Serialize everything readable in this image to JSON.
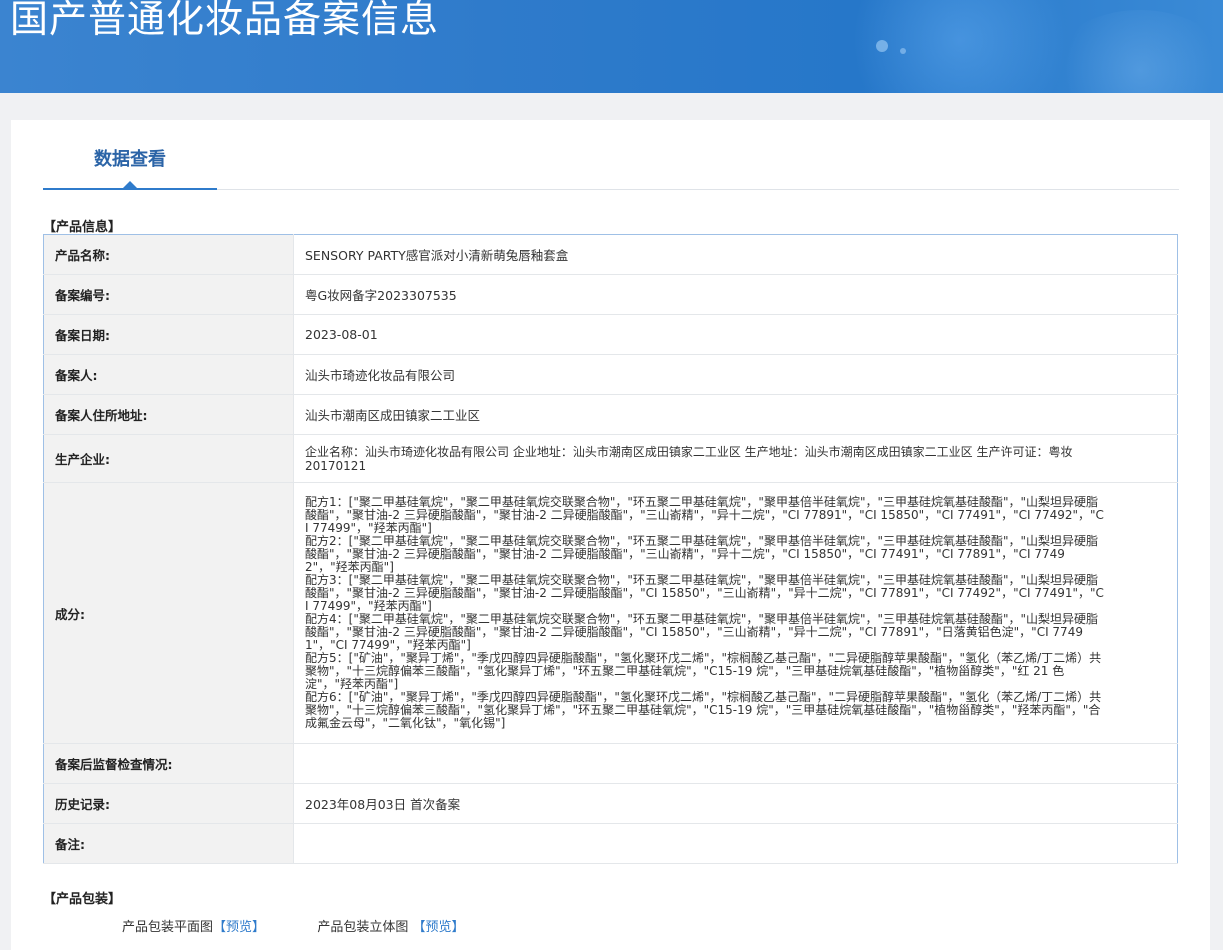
{
  "banner": {
    "title": "国产普通化妆品备案信息"
  },
  "tabs": {
    "active": "数据查看"
  },
  "section_product_info": "【产品信息】",
  "rows": [
    {
      "label": "产品名称:",
      "value": "SENSORY PARTY感官派对小清新萌兔唇釉套盒"
    },
    {
      "label": "备案编号:",
      "value": "粤G妆网备字2023307535"
    },
    {
      "label": "备案日期:",
      "value": "2023-08-01"
    },
    {
      "label": "备案人:",
      "value": "汕头市琦迹化妆品有限公司"
    },
    {
      "label": "备案人住所地址:",
      "value": "汕头市潮南区成田镇家二工业区"
    },
    {
      "label": "生产企业:",
      "value": "企业名称：汕头市琦迹化妆品有限公司 企业地址：汕头市潮南区成田镇家二工业区 生产地址：汕头市潮南区成田镇家二工业区 生产许可证：粤妆20170121"
    },
    {
      "label": "成分:",
      "value": ""
    },
    {
      "label": "备案后监督检查情况:",
      "value": ""
    },
    {
      "label": "历史记录:",
      "value": "2023年08月03日 首次备案"
    },
    {
      "label": "备注:",
      "value": ""
    }
  ],
  "ingredients": [
    "配方1：[\"聚二甲基硅氧烷\"，\"聚二甲基硅氧烷交联聚合物\"，\"环五聚二甲基硅氧烷\"，\"聚甲基倍半硅氧烷\"，\"三甲基硅烷氧基硅酸酯\"，\"山梨坦异硬脂酸酯\"，\"聚甘油-2 三异硬脂酸酯\"，\"聚甘油-2 二异硬脂酸酯\"，\"三山嵛精\"，\"异十二烷\"，\"CI 77891\"，\"CI 15850\"，\"CI 77491\"，\"CI 77492\"，\"CI 77499\"，\"羟苯丙酯\"]",
    "配方2：[\"聚二甲基硅氧烷\"，\"聚二甲基硅氧烷交联聚合物\"，\"环五聚二甲基硅氧烷\"，\"聚甲基倍半硅氧烷\"，\"三甲基硅烷氧基硅酸酯\"，\"山梨坦异硬脂酸酯\"，\"聚甘油-2 三异硬脂酸酯\"，\"聚甘油-2 二异硬脂酸酯\"，\"三山嵛精\"，\"异十二烷\"，\"CI 15850\"，\"CI 77491\"，\"CI 77891\"，\"CI 77492\"，\"羟苯丙酯\"]",
    "配方3：[\"聚二甲基硅氧烷\"，\"聚二甲基硅氧烷交联聚合物\"，\"环五聚二甲基硅氧烷\"，\"聚甲基倍半硅氧烷\"，\"三甲基硅烷氧基硅酸酯\"，\"山梨坦异硬脂酸酯\"，\"聚甘油-2 三异硬脂酸酯\"，\"聚甘油-2 二异硬脂酸酯\"，\"CI 15850\"，\"三山嵛精\"，\"异十二烷\"，\"CI 77891\"，\"CI 77492\"，\"CI 77491\"，\"CI 77499\"，\"羟苯丙酯\"]",
    "配方4：[\"聚二甲基硅氧烷\"，\"聚二甲基硅氧烷交联聚合物\"，\"环五聚二甲基硅氧烷\"，\"聚甲基倍半硅氧烷\"，\"三甲基硅烷氧基硅酸酯\"，\"山梨坦异硬脂酸酯\"，\"聚甘油-2 三异硬脂酸酯\"，\"聚甘油-2 二异硬脂酸酯\"，\"CI 15850\"，\"三山嵛精\"，\"异十二烷\"，\"CI 77891\"，\"日落黄铝色淀\"，\"CI 77491\"，\"CI 77499\"，\"羟苯丙酯\"]",
    "配方5：[\"矿油\"，\"聚异丁烯\"，\"季戊四醇四异硬脂酸酯\"，\"氢化聚环戊二烯\"，\"棕榈酸乙基己酯\"，\"二异硬脂醇苹果酸酯\"，\"氢化（苯乙烯/丁二烯）共聚物\"，\"十三烷醇偏苯三酸酯\"，\"氢化聚异丁烯\"，\"环五聚二甲基硅氧烷\"，\"C15-19 烷\"，\"三甲基硅烷氧基硅酸酯\"，\"植物甾醇类\"，\"红 21 色淀\"，\"羟苯丙酯\"]",
    "配方6：[\"矿油\"，\"聚异丁烯\"，\"季戊四醇四异硬脂酸酯\"，\"氢化聚环戊二烯\"，\"棕榈酸乙基己酯\"，\"二异硬脂醇苹果酸酯\"，\"氢化（苯乙烯/丁二烯）共聚物\"，\"十三烷醇偏苯三酸酯\"，\"氢化聚异丁烯\"，\"环五聚二甲基硅氧烷\"，\"C15-19 烷\"，\"三甲基硅烷氧基硅酸酯\"，\"植物甾醇类\"，\"羟苯丙酯\"，\"合成氟金云母\"，\"二氧化钛\"，\"氧化锡\"]"
  ],
  "section_packaging": "【产品包装】",
  "packaging": {
    "flat_label": "产品包装平面图",
    "flat_link": "【预览】",
    "solid_label": "产品包装立体图",
    "solid_link": "【预览】"
  }
}
